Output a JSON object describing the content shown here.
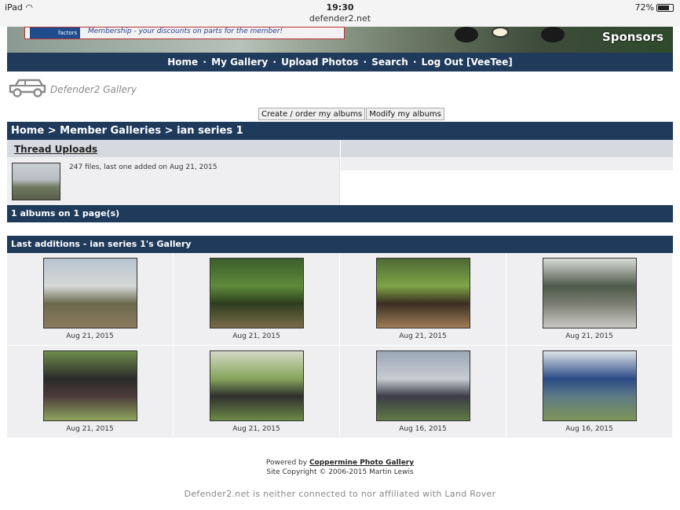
{
  "status_bar": {
    "device": "iPad",
    "time": "19:30",
    "host": "defender2.net",
    "battery": "72%"
  },
  "banner": {
    "ad_logo_text": "factors",
    "ad_tagline": "Membership - your discounts on parts for the member!",
    "sponsors_label": "Sponsors"
  },
  "nav": {
    "items": [
      "Home",
      "My Gallery",
      "Upload Photos",
      "Search",
      "Log Out [VeeTee]"
    ],
    "separator": "·"
  },
  "gallery": {
    "title": "Defender2 Gallery",
    "logo_icon": "land-rover-icon"
  },
  "album_buttons": {
    "create": "Create / order my albums",
    "modify": "Modify my albums"
  },
  "breadcrumb": {
    "home": "Home",
    "sep": ">",
    "member_galleries": "Member Galleries",
    "current": "ian series 1"
  },
  "album": {
    "title": "Thread Uploads",
    "info": "247 files, last one added on Aug 21, 2015"
  },
  "album_count": "1 albums on 1 page(s)",
  "last_additions": {
    "title": "Last additions - ian series 1's Gallery",
    "items": [
      {
        "date": "Aug 21, 2015",
        "colors": [
          "#b7c4cf",
          "#d5d9d6",
          "#6b6a4e",
          "#8b7b5e"
        ]
      },
      {
        "date": "Aug 21, 2015",
        "colors": [
          "#3c5d2c",
          "#5e8a3a",
          "#2e3e1e",
          "#7a6b4a"
        ]
      },
      {
        "date": "Aug 21, 2015",
        "colors": [
          "#4d6a36",
          "#7ea447",
          "#3a2e22",
          "#a07c55"
        ]
      },
      {
        "date": "Aug 21, 2015",
        "colors": [
          "#d9dcd8",
          "#4d5a4a",
          "#7b7d72",
          "#c9c9c2"
        ]
      },
      {
        "date": "Aug 21, 2015",
        "colors": [
          "#6e8d4c",
          "#2a2a2a",
          "#4b3b3b",
          "#8fa55e"
        ]
      },
      {
        "date": "Aug 21, 2015",
        "colors": [
          "#d3d8c6",
          "#86a45a",
          "#2f2f2f",
          "#6d8a45"
        ]
      },
      {
        "date": "Aug 16, 2015",
        "colors": [
          "#9aa7b6",
          "#c8ccd2",
          "#3c3c48",
          "#5f7a45"
        ]
      },
      {
        "date": "Aug 16, 2015",
        "colors": [
          "#dfe4e9",
          "#2a4a85",
          "#5d7a86",
          "#7e9557"
        ]
      }
    ]
  },
  "footer": {
    "powered_prefix": "Powered by",
    "powered_link": "Coppermine Photo Gallery",
    "copyright": "Site Copyright © 2006-2015 Martin Lewis",
    "disclaimer": "Defender2.net is neither connected to nor affiliated with Land Rover"
  }
}
